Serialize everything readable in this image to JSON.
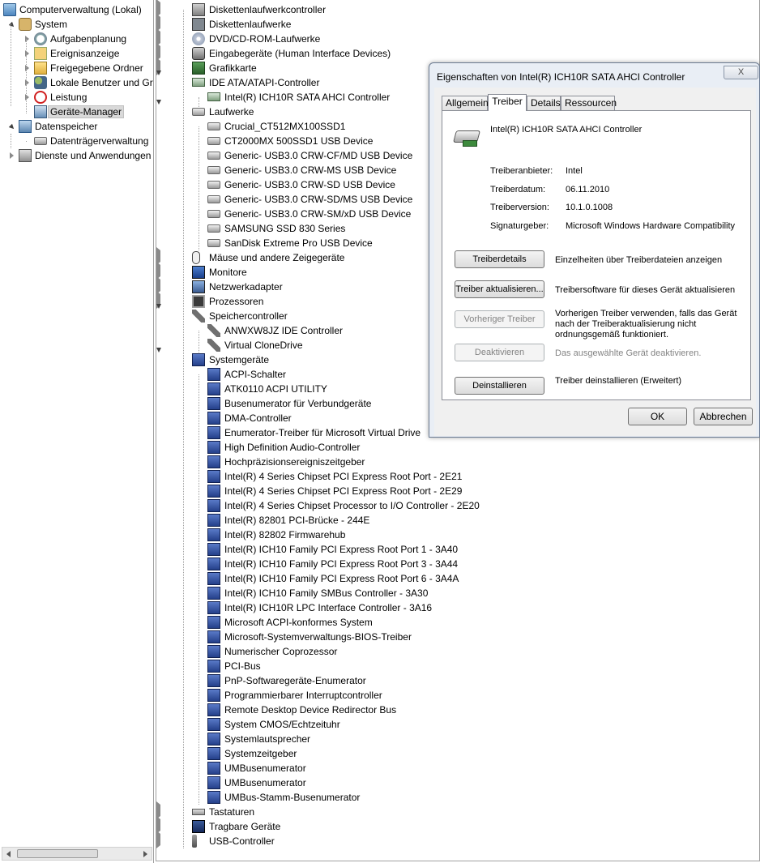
{
  "left_tree": [
    {
      "label": "Computerverwaltung (Lokal)",
      "icon": "computer-management-icon",
      "level": 0,
      "state": "none"
    },
    {
      "label": "System",
      "icon": "tools-icon",
      "level": 1,
      "state": "expanded"
    },
    {
      "label": "Aufgabenplanung",
      "icon": "task-scheduler-icon",
      "level": 2,
      "state": "collapsed"
    },
    {
      "label": "Ereignisanzeige",
      "icon": "event-viewer-icon",
      "level": 2,
      "state": "collapsed"
    },
    {
      "label": "Freigegebene Ordner",
      "icon": "shared-folders-icon",
      "level": 2,
      "state": "collapsed"
    },
    {
      "label": "Lokale Benutzer und Gru",
      "icon": "local-users-icon",
      "level": 2,
      "state": "collapsed"
    },
    {
      "label": "Leistung",
      "icon": "performance-icon",
      "level": 2,
      "state": "collapsed"
    },
    {
      "label": "Geräte-Manager",
      "icon": "device-manager-icon",
      "level": 2,
      "state": "none",
      "selected": true
    },
    {
      "label": "Datenspeicher",
      "icon": "storage-icon",
      "level": 1,
      "state": "expanded"
    },
    {
      "label": "Datenträgerverwaltung",
      "icon": "disk-management-icon",
      "level": 2,
      "state": "none"
    },
    {
      "label": "Dienste und Anwendungen",
      "icon": "services-icon",
      "level": 1,
      "state": "collapsed"
    }
  ],
  "device_tree": [
    {
      "label": "Diskettenlaufwerkcontroller",
      "icon": "floppy-controller-icon",
      "level": 0,
      "state": "collapsed"
    },
    {
      "label": "Diskettenlaufwerke",
      "icon": "floppy-drive-icon",
      "level": 0,
      "state": "collapsed"
    },
    {
      "label": "DVD/CD-ROM-Laufwerke",
      "icon": "dvd-drive-icon",
      "level": 0,
      "state": "collapsed"
    },
    {
      "label": "Eingabegeräte (Human Interface Devices)",
      "icon": "hid-icon",
      "level": 0,
      "state": "collapsed"
    },
    {
      "label": "Grafikkarte",
      "icon": "display-adapter-icon",
      "level": 0,
      "state": "collapsed"
    },
    {
      "label": "IDE ATA/ATAPI-Controller",
      "icon": "ide-controller-icon",
      "level": 0,
      "state": "expanded"
    },
    {
      "label": "Intel(R) ICH10R SATA AHCI Controller",
      "icon": "ide-controller-icon",
      "level": 1,
      "state": "none"
    },
    {
      "label": "Laufwerke",
      "icon": "disk-drive-icon",
      "level": 0,
      "state": "expanded"
    },
    {
      "label": "Crucial_CT512MX100SSD1",
      "icon": "disk-drive-icon",
      "level": 1,
      "state": "none"
    },
    {
      "label": "CT2000MX 500SSD1 USB Device",
      "icon": "disk-drive-icon",
      "level": 1,
      "state": "none"
    },
    {
      "label": "Generic- USB3.0 CRW-CF/MD USB Device",
      "icon": "disk-drive-icon",
      "level": 1,
      "state": "none"
    },
    {
      "label": "Generic- USB3.0 CRW-MS USB Device",
      "icon": "disk-drive-icon",
      "level": 1,
      "state": "none"
    },
    {
      "label": "Generic- USB3.0 CRW-SD USB Device",
      "icon": "disk-drive-icon",
      "level": 1,
      "state": "none"
    },
    {
      "label": "Generic- USB3.0 CRW-SD/MS USB Device",
      "icon": "disk-drive-icon",
      "level": 1,
      "state": "none"
    },
    {
      "label": "Generic- USB3.0 CRW-SM/xD USB Device",
      "icon": "disk-drive-icon",
      "level": 1,
      "state": "none"
    },
    {
      "label": "SAMSUNG SSD 830 Series",
      "icon": "disk-drive-icon",
      "level": 1,
      "state": "none"
    },
    {
      "label": "SanDisk Extreme Pro USB Device",
      "icon": "disk-drive-icon",
      "level": 1,
      "state": "none"
    },
    {
      "label": "Mäuse und andere Zeigegeräte",
      "icon": "mouse-icon",
      "level": 0,
      "state": "collapsed"
    },
    {
      "label": "Monitore",
      "icon": "monitor-icon",
      "level": 0,
      "state": "collapsed"
    },
    {
      "label": "Netzwerkadapter",
      "icon": "network-adapter-icon",
      "level": 0,
      "state": "collapsed"
    },
    {
      "label": "Prozessoren",
      "icon": "processor-icon",
      "level": 0,
      "state": "collapsed"
    },
    {
      "label": "Speichercontroller",
      "icon": "storage-controller-icon",
      "level": 0,
      "state": "expanded"
    },
    {
      "label": "ANWXW8JZ IDE Controller",
      "icon": "storage-controller-icon",
      "level": 1,
      "state": "none"
    },
    {
      "label": "Virtual CloneDrive",
      "icon": "storage-controller-icon",
      "level": 1,
      "state": "none"
    },
    {
      "label": "Systemgeräte",
      "icon": "system-device-icon",
      "level": 0,
      "state": "expanded"
    },
    {
      "label": "ACPI-Schalter",
      "icon": "system-device-icon",
      "level": 1,
      "state": "none"
    },
    {
      "label": "ATK0110 ACPI UTILITY",
      "icon": "system-device-icon",
      "level": 1,
      "state": "none"
    },
    {
      "label": "Busenumerator für Verbundgeräte",
      "icon": "system-device-icon",
      "level": 1,
      "state": "none"
    },
    {
      "label": "DMA-Controller",
      "icon": "system-device-icon",
      "level": 1,
      "state": "none"
    },
    {
      "label": "Enumerator-Treiber für Microsoft Virtual Drive",
      "icon": "system-device-icon",
      "level": 1,
      "state": "none"
    },
    {
      "label": "High Definition Audio-Controller",
      "icon": "system-device-icon",
      "level": 1,
      "state": "none"
    },
    {
      "label": "Hochpräzisionsereigniszeitgeber",
      "icon": "system-device-icon",
      "level": 1,
      "state": "none"
    },
    {
      "label": "Intel(R) 4 Series Chipset PCI Express Root Port - 2E21",
      "icon": "system-device-icon",
      "level": 1,
      "state": "none"
    },
    {
      "label": "Intel(R) 4 Series Chipset PCI Express Root Port - 2E29",
      "icon": "system-device-icon",
      "level": 1,
      "state": "none"
    },
    {
      "label": "Intel(R) 4 Series Chipset Processor to I/O Controller - 2E20",
      "icon": "system-device-icon",
      "level": 1,
      "state": "none"
    },
    {
      "label": "Intel(R) 82801 PCI-Brücke - 244E",
      "icon": "system-device-icon",
      "level": 1,
      "state": "none"
    },
    {
      "label": "Intel(R) 82802 Firmwarehub",
      "icon": "system-device-icon",
      "level": 1,
      "state": "none"
    },
    {
      "label": "Intel(R) ICH10 Family PCI Express Root Port 1 - 3A40",
      "icon": "system-device-icon",
      "level": 1,
      "state": "none"
    },
    {
      "label": "Intel(R) ICH10 Family PCI Express Root Port 3 - 3A44",
      "icon": "system-device-icon",
      "level": 1,
      "state": "none"
    },
    {
      "label": "Intel(R) ICH10 Family PCI Express Root Port 6 - 3A4A",
      "icon": "system-device-icon",
      "level": 1,
      "state": "none"
    },
    {
      "label": "Intel(R) ICH10 Family SMBus Controller - 3A30",
      "icon": "system-device-icon",
      "level": 1,
      "state": "none"
    },
    {
      "label": "Intel(R) ICH10R LPC Interface Controller - 3A16",
      "icon": "system-device-icon",
      "level": 1,
      "state": "none"
    },
    {
      "label": "Microsoft ACPI-konformes System",
      "icon": "system-device-icon",
      "level": 1,
      "state": "none"
    },
    {
      "label": "Microsoft-Systemverwaltungs-BIOS-Treiber",
      "icon": "system-device-icon",
      "level": 1,
      "state": "none"
    },
    {
      "label": "Numerischer Coprozessor",
      "icon": "system-device-icon",
      "level": 1,
      "state": "none"
    },
    {
      "label": "PCI-Bus",
      "icon": "system-device-icon",
      "level": 1,
      "state": "none"
    },
    {
      "label": "PnP-Softwaregeräte-Enumerator",
      "icon": "system-device-icon",
      "level": 1,
      "state": "none"
    },
    {
      "label": "Programmierbarer Interruptcontroller",
      "icon": "system-device-icon",
      "level": 1,
      "state": "none"
    },
    {
      "label": "Remote Desktop Device Redirector Bus",
      "icon": "system-device-icon",
      "level": 1,
      "state": "none"
    },
    {
      "label": "System CMOS/Echtzeituhr",
      "icon": "system-device-icon",
      "level": 1,
      "state": "none"
    },
    {
      "label": "Systemlautsprecher",
      "icon": "system-device-icon",
      "level": 1,
      "state": "none"
    },
    {
      "label": "Systemzeitgeber",
      "icon": "system-device-icon",
      "level": 1,
      "state": "none"
    },
    {
      "label": "UMBusenumerator",
      "icon": "system-device-icon",
      "level": 1,
      "state": "none"
    },
    {
      "label": "UMBusenumerator",
      "icon": "system-device-icon",
      "level": 1,
      "state": "none"
    },
    {
      "label": "UMBus-Stamm-Busenumerator",
      "icon": "system-device-icon",
      "level": 1,
      "state": "none"
    },
    {
      "label": "Tastaturen",
      "icon": "keyboard-icon",
      "level": 0,
      "state": "collapsed"
    },
    {
      "label": "Tragbare Geräte",
      "icon": "portable-device-icon",
      "level": 0,
      "state": "collapsed"
    },
    {
      "label": "USB-Controller",
      "icon": "usb-controller-icon",
      "level": 0,
      "state": "collapsed"
    }
  ],
  "dialog": {
    "title": "Eigenschaften von Intel(R) ICH10R SATA AHCI Controller",
    "close_label": "X",
    "tabs": [
      {
        "label": "Allgemein",
        "active": false
      },
      {
        "label": "Treiber",
        "active": true
      },
      {
        "label": "Details",
        "active": false
      },
      {
        "label": "Ressourcen",
        "active": false
      }
    ],
    "device_name": "Intel(R) ICH10R SATA AHCI Controller",
    "properties": [
      {
        "label": "Treiberanbieter:",
        "value": "Intel"
      },
      {
        "label": "Treiberdatum:",
        "value": "06.11.2010"
      },
      {
        "label": "Treiberversion:",
        "value": "10.1.0.1008"
      },
      {
        "label": "Signaturgeber:",
        "value": "Microsoft Windows Hardware Compatibility"
      }
    ],
    "actions": [
      {
        "button": "Treiberdetails",
        "description": "Einzelheiten über Treiberdateien anzeigen",
        "enabled": true
      },
      {
        "button": "Treiber aktualisieren...",
        "description": "Treibersoftware für dieses Gerät aktualisieren",
        "enabled": true
      },
      {
        "button": "Vorheriger Treiber",
        "description": "Vorherigen Treiber verwenden, falls das Gerät nach der Treiberaktualisierung nicht ordnungsgemäß funktioniert.",
        "enabled": false
      },
      {
        "button": "Deaktivieren",
        "description": "Das ausgewählte Gerät deaktivieren.",
        "enabled": false
      },
      {
        "button": "Deinstallieren",
        "description": "Treiber deinstallieren (Erweitert)",
        "enabled": true
      }
    ],
    "ok_label": "OK",
    "cancel_label": "Abbrechen"
  }
}
